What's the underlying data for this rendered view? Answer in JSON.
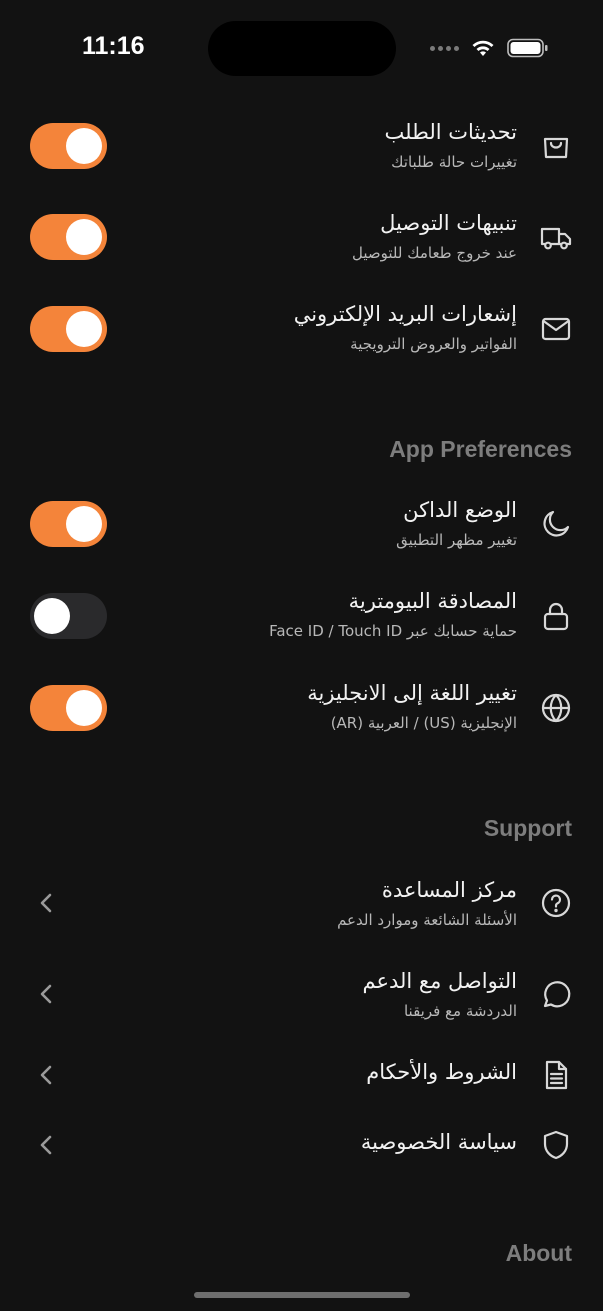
{
  "status_bar": {
    "time": "11:16"
  },
  "notifications": {
    "items": [
      {
        "title": "تحديثات الطلب",
        "subtitle": "تغييرات حالة طلباتك",
        "icon": "shopping-bag-icon",
        "enabled": true
      },
      {
        "title": "تنبيهات التوصيل",
        "subtitle": "عند خروج طعامك للتوصيل",
        "icon": "truck-icon",
        "enabled": true
      },
      {
        "title": "إشعارات البريد الإلكتروني",
        "subtitle": "الفواتير والعروض الترويجية",
        "icon": "mail-icon",
        "enabled": true
      }
    ]
  },
  "app_preferences": {
    "header": "App Preferences",
    "items": [
      {
        "title": "الوضع الداكن",
        "subtitle": "تغيير مظهر التطبيق",
        "icon": "moon-icon",
        "enabled": true
      },
      {
        "title": "المصادقة البيومترية",
        "subtitle": "حماية حسابك عبر Face ID / Touch ID",
        "icon": "lock-icon",
        "enabled": false
      },
      {
        "title": "تغيير اللغة إلى الانجليزية",
        "subtitle": "الإنجليزية (US) / العربية (AR)",
        "icon": "globe-icon",
        "enabled": true
      }
    ]
  },
  "support": {
    "header": "Support",
    "items": [
      {
        "title": "مركز المساعدة",
        "subtitle": "الأسئلة الشائعة وموارد الدعم",
        "icon": "help-circle-icon"
      },
      {
        "title": "التواصل مع الدعم",
        "subtitle": "الدردشة مع فريقنا",
        "icon": "chat-bubble-icon"
      },
      {
        "title": "الشروط والأحكام",
        "icon": "document-icon"
      },
      {
        "title": "سياسة الخصوصية",
        "icon": "shield-icon"
      }
    ]
  },
  "about": {
    "header": "About"
  },
  "colors": {
    "background": "#121212",
    "accent": "#f4843a",
    "toggle_off": "#2a2a2c"
  }
}
